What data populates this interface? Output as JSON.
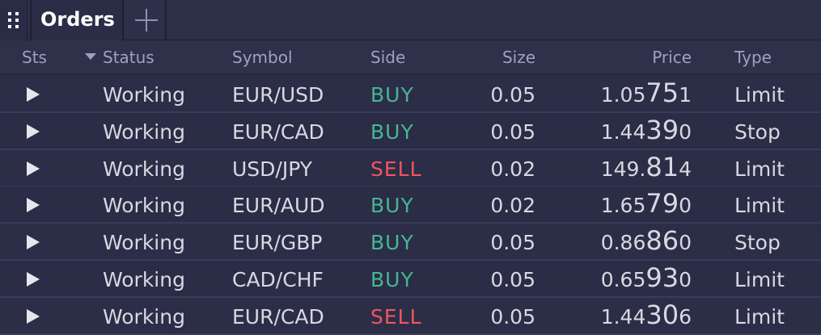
{
  "tab": {
    "title": "Orders",
    "grip_icon": "drag-handle-icon",
    "add_icon": "plus-icon"
  },
  "columns": {
    "sts": "Sts",
    "status": "Status",
    "symbol": "Symbol",
    "side": "Side",
    "size": "Size",
    "price": "Price",
    "type": "Type"
  },
  "colors": {
    "buy": "#45b793",
    "sell": "#f0565e",
    "background": "#2b2c45"
  },
  "rows": [
    {
      "status": "Working",
      "symbol": "EUR/USD",
      "side": "BUY",
      "size": "0.05",
      "price_pre": "1.05",
      "price_big": "75",
      "price_post": "1",
      "type": "Limit"
    },
    {
      "status": "Working",
      "symbol": "EUR/CAD",
      "side": "BUY",
      "size": "0.05",
      "price_pre": "1.44",
      "price_big": "39",
      "price_post": "0",
      "type": "Stop"
    },
    {
      "status": "Working",
      "symbol": "USD/JPY",
      "side": "SELL",
      "size": "0.02",
      "price_pre": "149.",
      "price_big": "81",
      "price_post": "4",
      "type": "Limit"
    },
    {
      "status": "Working",
      "symbol": "EUR/AUD",
      "side": "BUY",
      "size": "0.02",
      "price_pre": "1.65",
      "price_big": "79",
      "price_post": "0",
      "type": "Limit"
    },
    {
      "status": "Working",
      "symbol": "EUR/GBP",
      "side": "BUY",
      "size": "0.05",
      "price_pre": "0.86",
      "price_big": "86",
      "price_post": "0",
      "type": "Stop"
    },
    {
      "status": "Working",
      "symbol": "CAD/CHF",
      "side": "BUY",
      "size": "0.05",
      "price_pre": "0.65",
      "price_big": "93",
      "price_post": "0",
      "type": "Limit"
    },
    {
      "status": "Working",
      "symbol": "EUR/CAD",
      "side": "SELL",
      "size": "0.05",
      "price_pre": "1.44",
      "price_big": "30",
      "price_post": "6",
      "type": "Limit"
    }
  ]
}
